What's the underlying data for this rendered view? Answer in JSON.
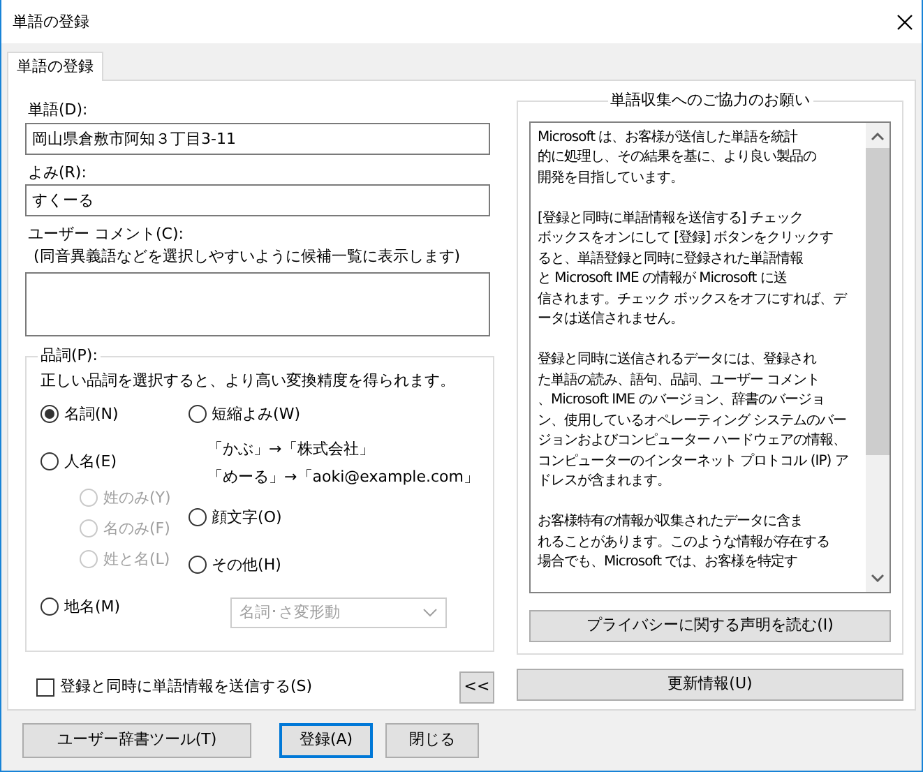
{
  "window": {
    "title": "単語の登録"
  },
  "tabs": [
    {
      "label": "単語の登録",
      "selected": true
    }
  ],
  "word": {
    "label": "単語(D):",
    "value": "岡山県倉敷市阿知３丁目3-11"
  },
  "reading": {
    "label": "よみ(R):",
    "value": "すくーる"
  },
  "comment": {
    "label": "ユーザー コメント(C):",
    "hint": "(同音異義語などを選択しやすいように候補一覧に表示します)"
  },
  "part_of_speech": {
    "legend": "品詞(P):",
    "hint": "正しい品詞を選択すると、より高い変換精度を得られます。",
    "left_options": [
      {
        "label": "名詞(N)",
        "selected": true,
        "disabled": false
      },
      {
        "label": "人名(E)",
        "selected": false,
        "disabled": false,
        "children": [
          {
            "label": "姓のみ(Y)",
            "selected": false,
            "disabled": true
          },
          {
            "label": "名のみ(F)",
            "selected": false,
            "disabled": true
          },
          {
            "label": "姓と名(L)",
            "selected": false,
            "disabled": true
          }
        ]
      },
      {
        "label": "地名(M)",
        "selected": false,
        "disabled": false
      }
    ],
    "right_options": [
      {
        "label": "短縮よみ(W)",
        "selected": false,
        "disabled": false,
        "examples": [
          "「かぶ」→「株式会社」",
          "「めーる」→「aoki@example.com」"
        ]
      },
      {
        "label": "顔文字(O)",
        "selected": false,
        "disabled": false
      },
      {
        "label": "その他(H)",
        "selected": false,
        "disabled": false
      }
    ],
    "subtype_dropdown": {
      "value": "名詞･さ変形動",
      "disabled": true
    }
  },
  "send_checkbox": {
    "label": "登録と同時に単語情報を送信する(S)",
    "checked": false
  },
  "collapse_button": "<<",
  "info_panel": {
    "legend": "単語収集へのご協力のお願い",
    "paragraphs": [
      [
        "Microsoft は、お客様が送信した単語を統計",
        "的に処理し、その結果を基に、より良い製品の",
        "開発を目指しています。"
      ],
      [
        "[登録と同時に単語情報を送信する] チェック",
        "ボックスをオンにして [登録] ボタンをクリックす",
        "ると、単語登録と同時に登録された単語情報",
        "と Microsoft IME の情報が Microsoft に送",
        "信されます。チェック ボックスをオフにすれば、デ",
        "ータは送信されません。"
      ],
      [
        "登録と同時に送信されるデータには、登録され",
        "た単語の読み、語句、品詞、ユーザー コメント",
        "、Microsoft IME のバージョン、辞書のバージョ",
        "ン、使用しているオペレーティング システムのバー",
        "ジョンおよびコンピューター ハードウェアの情報、",
        "コンピューターのインターネット プロトコル (IP) ア",
        "ドレスが含まれます。"
      ],
      [
        "お客様特有の情報が収集されたデータに含ま",
        "れることがあります。このような情報が存在する",
        "場合でも、Microsoft では、お客様を特定す"
      ]
    ],
    "privacy_button": "プライバシーに関する声明を読む(I)"
  },
  "update_button": "更新情報(U)",
  "bottom_buttons": [
    {
      "label": "ユーザー辞書ツール(T)",
      "default": false
    },
    {
      "label": "登録(A)",
      "default": true
    },
    {
      "label": "閉じる",
      "default": false
    }
  ]
}
